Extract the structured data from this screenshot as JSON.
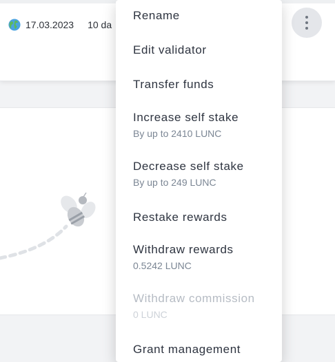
{
  "validator_row": {
    "date": "17.03.2023",
    "days_partial": "10 da"
  },
  "icons": {
    "globe": "globe-icon",
    "more": "more-vertical-icon",
    "bee": "bee-illustration-icon"
  },
  "menu": {
    "rename": {
      "label": "Rename"
    },
    "edit_validator": {
      "label": "Edit validator"
    },
    "transfer_funds": {
      "label": "Transfer funds"
    },
    "increase_self_stake": {
      "label": "Increase self stake",
      "sub": "By up to 2410 LUNC"
    },
    "decrease_self_stake": {
      "label": "Decrease self stake",
      "sub": "By up to 249 LUNC"
    },
    "restake_rewards": {
      "label": "Restake rewards"
    },
    "withdraw_rewards": {
      "label": "Withdraw rewards",
      "sub": "0.5242 LUNC"
    },
    "withdraw_commission": {
      "label": "Withdraw commission",
      "sub": "0 LUNC"
    },
    "grant_management": {
      "label": "Grant management"
    }
  }
}
